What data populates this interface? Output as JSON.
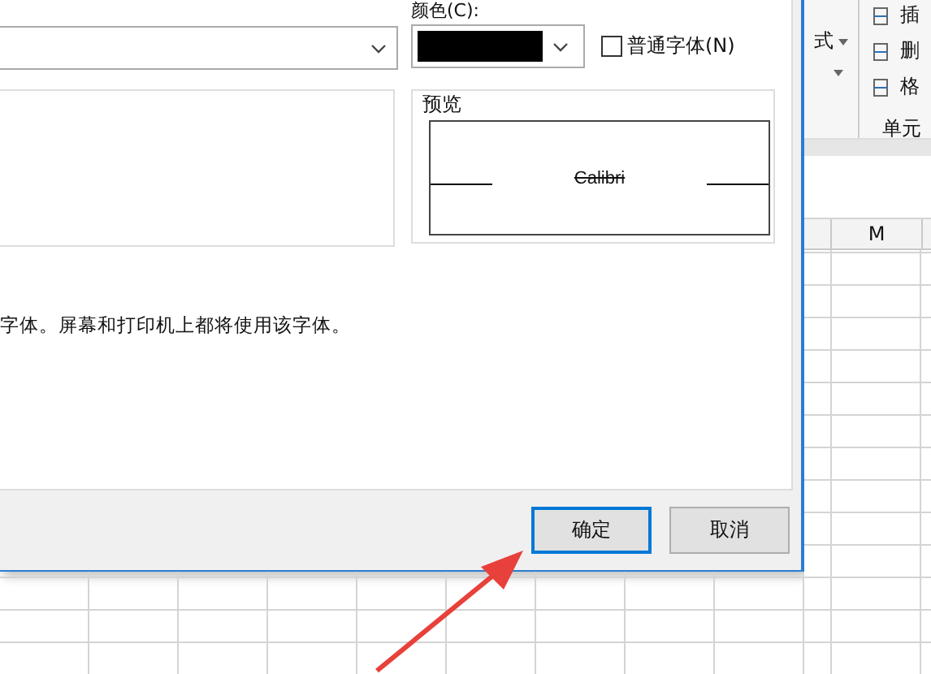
{
  "dialog": {
    "color_label": "颜色(C):",
    "normal_font": {
      "label": "普通字体(N)",
      "checked": false
    },
    "preview": {
      "label": "预览",
      "sample": "Calibri",
      "strikethrough": true
    },
    "description": "字体。屏幕和打印机上都将使用该字体。",
    "buttons": [
      {
        "label": "确定",
        "selected": true
      },
      {
        "label": "取消",
        "selected": false
      }
    ]
  },
  "ribbon": {
    "items": [
      "式",
      "插",
      "删",
      "格"
    ],
    "group_label": "单元"
  },
  "sheet": {
    "column_header": "M"
  }
}
